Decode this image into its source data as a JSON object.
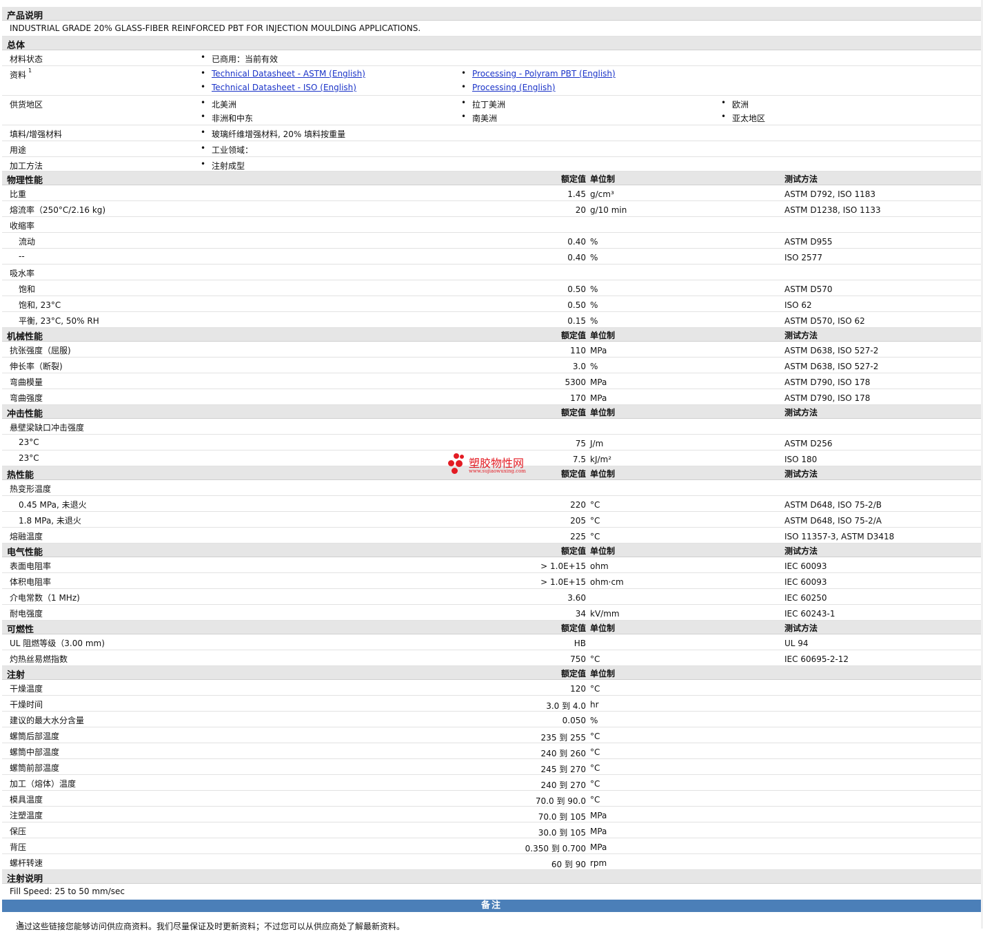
{
  "sections": {
    "product": "产品说明",
    "general": "总体",
    "physical": "物理性能",
    "mechanical": "机械性能",
    "impact": "冲击性能",
    "thermal": "热性能",
    "electrical": "电气性能",
    "flammability": "可燃性",
    "injection": "注射",
    "injection_notes": "注射说明"
  },
  "headers": {
    "nominal": "额定值",
    "unit": "单位制",
    "test": "测试方法"
  },
  "product_description": "INDUSTRIAL GRADE 20% GLASS-FIBER REINFORCED PBT FOR INJECTION MOULDING APPLICATIONS.",
  "general": {
    "status_label": "材料状态",
    "status_value": "已商用：当前有效",
    "docs_label": "资料",
    "docs_sup": "1",
    "docs": [
      "Technical Datasheet - ASTM (English)",
      "Processing - Polyram PBT (English)",
      "Technical Datasheet - ISO (English)",
      "Processing (English)"
    ],
    "region_label": "供货地区",
    "regions": [
      "北美洲",
      "拉丁美洲",
      "欧洲",
      "非洲和中东",
      "南美洲",
      "亚太地区"
    ],
    "filler_label": "填料/增强材料",
    "filler_value": "玻璃纤维增强材料, 20% 填料按重量",
    "use_label": "用途",
    "use_value": "工业领域：",
    "process_label": "加工方法",
    "process_value": "注射成型"
  },
  "physical": [
    {
      "label": "比重",
      "value": "1.45",
      "unit": "g/cm³",
      "test": "ASTM D792, ISO 1183"
    },
    {
      "label": "熔流率（250°C/2.16 kg)",
      "value": "20",
      "unit": "g/10 min",
      "test": "ASTM D1238, ISO 1133"
    },
    {
      "label": "收缩率",
      "value": "",
      "unit": "",
      "test": ""
    },
    {
      "label": "流动",
      "value": "0.40",
      "unit": "%",
      "test": "ASTM D955",
      "indent": true
    },
    {
      "label": "--",
      "value": "0.40",
      "unit": "%",
      "test": "ISO 2577",
      "indent": true
    },
    {
      "label": "吸水率",
      "value": "",
      "unit": "",
      "test": ""
    },
    {
      "label": "饱和",
      "value": "0.50",
      "unit": "%",
      "test": "ASTM D570",
      "indent": true
    },
    {
      "label": "饱和, 23°C",
      "value": "0.50",
      "unit": "%",
      "test": "ISO 62",
      "indent": true
    },
    {
      "label": "平衡, 23°C, 50% RH",
      "value": "0.15",
      "unit": "%",
      "test": "ASTM D570, ISO 62",
      "indent": true
    }
  ],
  "mechanical": [
    {
      "label": "抗张强度（屈服)",
      "value": "110",
      "unit": "MPa",
      "test": "ASTM D638, ISO 527-2"
    },
    {
      "label": "伸长率（断裂)",
      "value": "3.0",
      "unit": "%",
      "test": "ASTM D638, ISO 527-2"
    },
    {
      "label": "弯曲模量",
      "value": "5300",
      "unit": "MPa",
      "test": "ASTM D790, ISO 178"
    },
    {
      "label": "弯曲强度",
      "value": "170",
      "unit": "MPa",
      "test": "ASTM D790, ISO 178"
    }
  ],
  "impact": [
    {
      "label": "悬壁梁缺口冲击强度",
      "value": "",
      "unit": "",
      "test": ""
    },
    {
      "label": "23°C",
      "value": "75",
      "unit": "J/m",
      "test": "ASTM D256",
      "indent": true
    },
    {
      "label": "23°C",
      "value": "7.5",
      "unit": "kJ/m²",
      "test": "ISO 180",
      "indent": true
    }
  ],
  "thermal": [
    {
      "label": "热变形温度",
      "value": "",
      "unit": "",
      "test": ""
    },
    {
      "label": "0.45 MPa, 未退火",
      "value": "220",
      "unit": "°C",
      "test": "ASTM D648, ISO 75-2/B",
      "indent": true
    },
    {
      "label": "1.8 MPa, 未退火",
      "value": "205",
      "unit": "°C",
      "test": "ASTM D648, ISO 75-2/A",
      "indent": true
    },
    {
      "label": "熔融温度",
      "value": "225",
      "unit": "°C",
      "test": "ISO 11357-3, ASTM D3418"
    }
  ],
  "electrical": [
    {
      "label": "表面电阻率",
      "value": "> 1.0E+15",
      "unit": "ohm",
      "test": "IEC 60093"
    },
    {
      "label": "体积电阻率",
      "value": "> 1.0E+15",
      "unit": "ohm·cm",
      "test": "IEC 60093"
    },
    {
      "label": "介电常数（1 MHz)",
      "value": "3.60",
      "unit": "",
      "test": "IEC 60250"
    },
    {
      "label": "耐电强度",
      "value": "34",
      "unit": "kV/mm",
      "test": "IEC 60243-1"
    }
  ],
  "flammability": [
    {
      "label": "UL 阻燃等级（3.00 mm)",
      "value": "HB",
      "unit": "",
      "test": "UL 94"
    },
    {
      "label": "灼热丝易燃指数",
      "value": "750",
      "unit": "°C",
      "test": "IEC 60695-2-12"
    }
  ],
  "injection": [
    {
      "label": "干燥温度",
      "value": "120",
      "unit": "°C",
      "test": ""
    },
    {
      "label": "干燥时间",
      "value": "3.0 到  4.0",
      "unit": "hr",
      "test": ""
    },
    {
      "label": "建议的最大水分含量",
      "value": "0.050",
      "unit": "%",
      "test": ""
    },
    {
      "label": "螺筒后部温度",
      "value": "235 到  255",
      "unit": "°C",
      "test": ""
    },
    {
      "label": "螺筒中部温度",
      "value": "240 到  260",
      "unit": "°C",
      "test": ""
    },
    {
      "label": "螺筒前部温度",
      "value": "245 到  270",
      "unit": "°C",
      "test": ""
    },
    {
      "label": "加工（熔体）温度",
      "value": "240 到  270",
      "unit": "°C",
      "test": ""
    },
    {
      "label": "模具温度",
      "value": "70.0 到  90.0",
      "unit": "°C",
      "test": ""
    },
    {
      "label": "注塑温度",
      "value": "70.0 到  105",
      "unit": "MPa",
      "test": ""
    },
    {
      "label": "保压",
      "value": "30.0 到  105",
      "unit": "MPa",
      "test": ""
    },
    {
      "label": "背压",
      "value": "0.350 到  0.700",
      "unit": "MPa",
      "test": ""
    },
    {
      "label": "螺杆转速",
      "value": "60 到  90",
      "unit": "rpm",
      "test": ""
    }
  ],
  "injection_notes_text": "Fill Speed: 25 to 50 mm/sec",
  "notes_bar": "备注",
  "footnote_num": "1",
  "footnote": "通过这些链接您能够访问供应商资料。我们尽量保证及时更新资料；不过您可以从供应商处了解最新资料。",
  "watermark": {
    "cn": "塑胶物性网",
    "url": "www.sujiaowuxing.com",
    "color": "#e31b23"
  }
}
